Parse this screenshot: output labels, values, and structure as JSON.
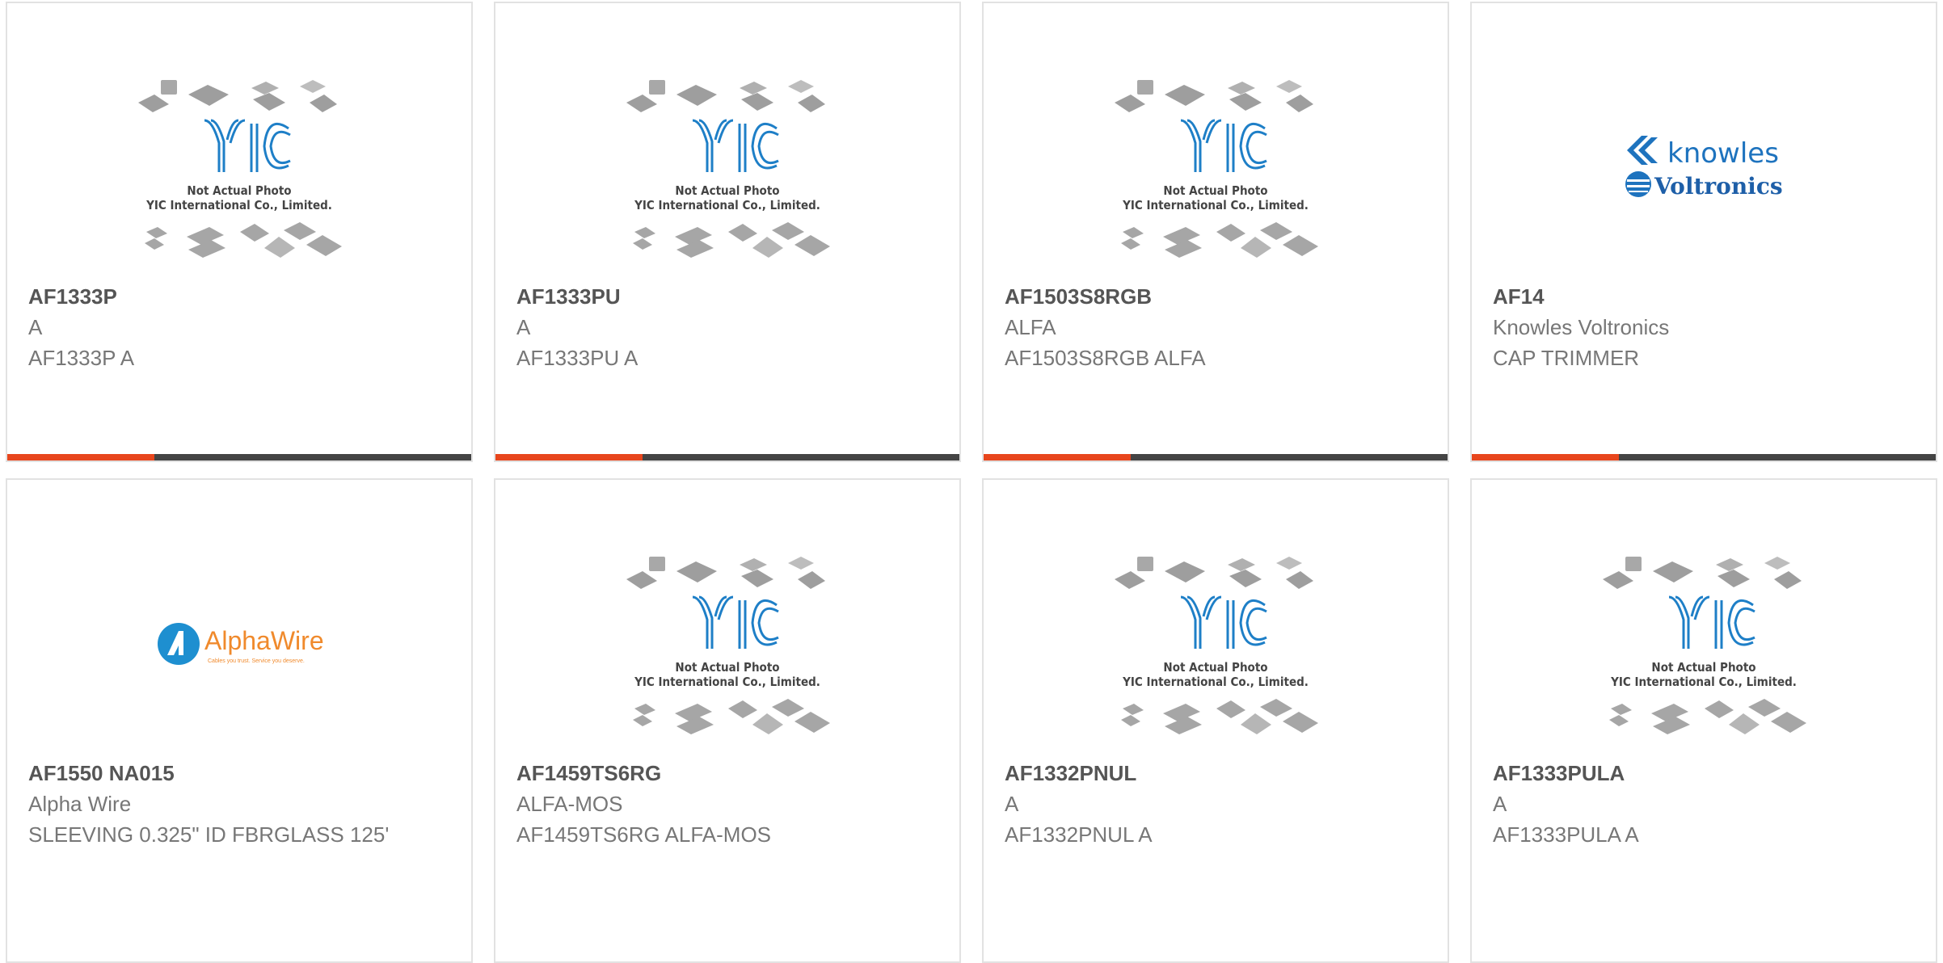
{
  "products": [
    {
      "part_number": "AF1333P",
      "manufacturer": "A",
      "description": "AF1333P A",
      "image": "not-actual-photo"
    },
    {
      "part_number": "AF1333PU",
      "manufacturer": "A",
      "description": "AF1333PU A",
      "image": "not-actual-photo"
    },
    {
      "part_number": "AF1503S8RGB",
      "manufacturer": "ALFA",
      "description": "AF1503S8RGB ALFA",
      "image": "not-actual-photo"
    },
    {
      "part_number": "AF14",
      "manufacturer": "Knowles Voltronics",
      "description": "CAP TRIMMER",
      "image": "knowles-voltronics-logo"
    },
    {
      "part_number": "AF1550 NA015",
      "manufacturer": "Alpha Wire",
      "description": "SLEEVING 0.325\" ID FBRGLASS 125'",
      "image": "alphawire-logo"
    },
    {
      "part_number": "AF1459TS6RG",
      "manufacturer": "ALFA-MOS",
      "description": "AF1459TS6RG ALFA-MOS",
      "image": "not-actual-photo"
    },
    {
      "part_number": "AF1332PNUL",
      "manufacturer": "A",
      "description": "AF1332PNUL A",
      "image": "not-actual-photo"
    },
    {
      "part_number": "AF1333PULA",
      "manufacturer": "A",
      "description": "AF1333PULA A",
      "image": "not-actual-photo"
    }
  ],
  "placeholder_image": {
    "line1": "Not Actual Photo",
    "line2": "YIC International Co., Limited."
  },
  "logos": {
    "knowles": "knowles",
    "voltronics": "Voltronics",
    "alphawire": "AlphaWire",
    "alphawire_tagline": "Cables you trust. Service you deserve."
  },
  "colors": {
    "accent": "#e8461d",
    "bar": "#444444",
    "yic_blue": "#1e7fc7"
  }
}
